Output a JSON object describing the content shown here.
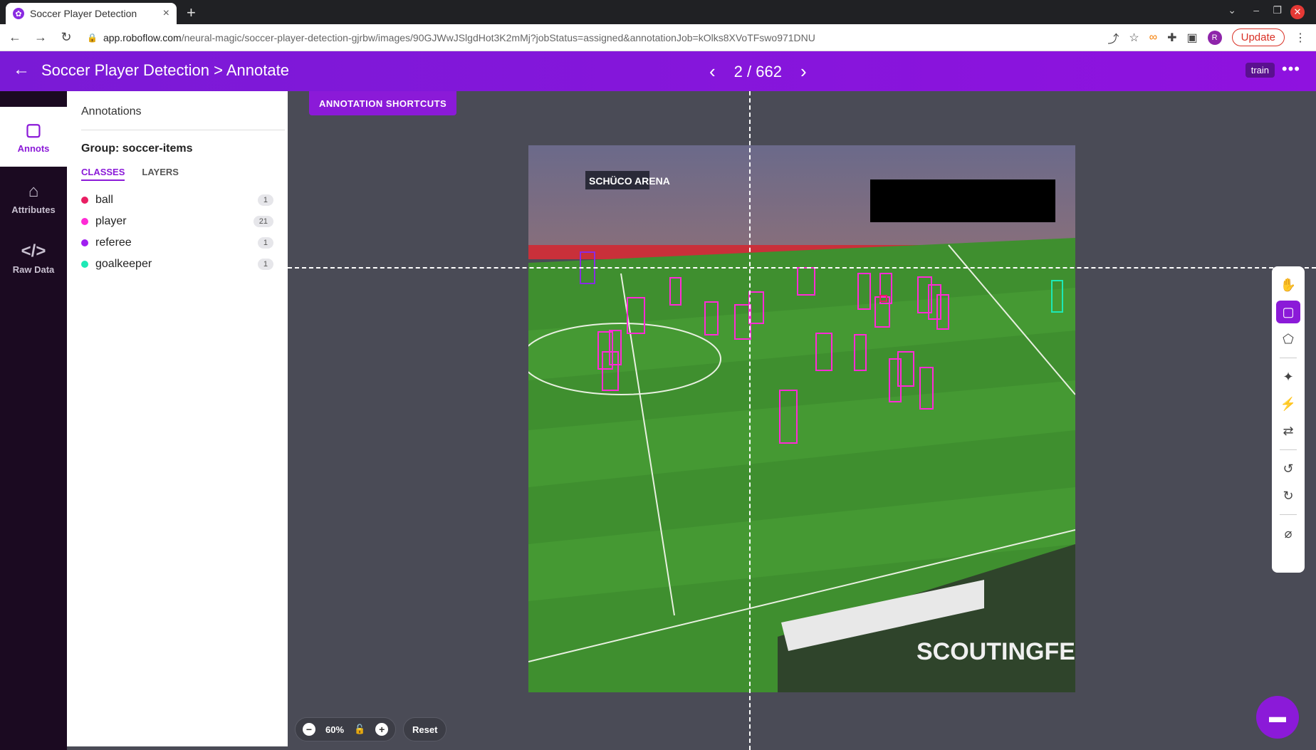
{
  "browser": {
    "tab_title": "Soccer Player Detection",
    "new_tab": "+",
    "url_domain": "app.roboflow.com",
    "url_path": "/neural-magic/soccer-player-detection-gjrbw/images/90GJWwJSlgdHot3K2mMj?jobStatus=assigned&annotationJob=kOlks8XVoTFswo971DNU",
    "profile_initial": "R",
    "update_label": "Update"
  },
  "appbar": {
    "title": "Soccer Player Detection > Annotate",
    "page_current": "2",
    "page_total": "662",
    "page_text": "2 / 662",
    "split_badge": "train"
  },
  "rail": {
    "items": [
      {
        "label": "Annots",
        "icon": "annotations-icon"
      },
      {
        "label": "Attributes",
        "icon": "tag-icon"
      },
      {
        "label": "Raw Data",
        "icon": "code-icon"
      }
    ]
  },
  "panel": {
    "title": "Annotations",
    "group": "Group: soccer-items",
    "tabs": [
      "CLASSES",
      "LAYERS"
    ],
    "classes": [
      {
        "name": "ball",
        "count": "1",
        "color": "#e91e63"
      },
      {
        "name": "player",
        "count": "21",
        "color": "#ff2bd6"
      },
      {
        "name": "referee",
        "count": "1",
        "color": "#a020f0"
      },
      {
        "name": "goalkeeper",
        "count": "1",
        "color": "#1de9b6"
      }
    ]
  },
  "canvas": {
    "shortcuts_label": "ANNOTATION SHORTCUTS",
    "zoom_level": "60%",
    "reset_label": "Reset",
    "image_watermark": "SCOUTINGFEED",
    "stadium_sign": "SCHÜCO ARENA"
  },
  "colors": {
    "brand": "#8b1ad8",
    "player_box": "#ff2bd6",
    "referee_box": "#a020f0",
    "goalkeeper_box": "#1de9b6"
  }
}
